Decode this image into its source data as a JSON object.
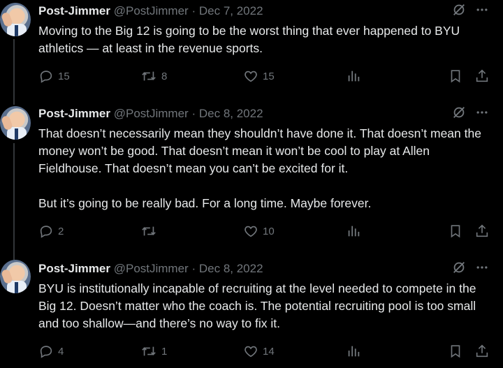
{
  "theme": {
    "background": "#000000",
    "text": "#e7e9ea",
    "muted": "#71767b",
    "thread_line": "#333639"
  },
  "tweets": [
    {
      "name": "Post-Jimmer",
      "handle": "@PostJimmer",
      "separator": "·",
      "date": "Dec 7, 2022",
      "paragraphs": [
        "Moving to the Big 12 is going to be the worst thing that ever happened to BYU athletics — at least in the revenue sports."
      ],
      "replies": "15",
      "retweets": "8",
      "likes": "15"
    },
    {
      "name": "Post-Jimmer",
      "handle": "@PostJimmer",
      "separator": "·",
      "date": "Dec 8, 2022",
      "paragraphs": [
        "That doesn’t necessarily mean they shouldn’t have done it. That doesn’t mean the money won’t be good. That doesn’t mean it won’t be cool to play at Allen Fieldhouse. That doesn’t mean you can’t be excited for it.",
        "But it’s going to be really bad. For a long time. Maybe forever."
      ],
      "replies": "2",
      "retweets": "",
      "likes": "10"
    },
    {
      "name": "Post-Jimmer",
      "handle": "@PostJimmer",
      "separator": "·",
      "date": "Dec 8, 2022",
      "paragraphs": [
        "BYU is institutionally incapable of recruiting at the level needed to compete in the Big 12. Doesn’t matter who the coach is. The potential recruiting pool is too small and too shallow—and there’s no way to fix it."
      ],
      "replies": "4",
      "retweets": "1",
      "likes": "14"
    }
  ],
  "icons": {
    "top": [
      "grok-icon",
      "more-icon"
    ],
    "actions": [
      "reply-icon",
      "retweet-icon",
      "like-icon",
      "views-icon",
      "bookmark-icon",
      "share-icon"
    ]
  }
}
